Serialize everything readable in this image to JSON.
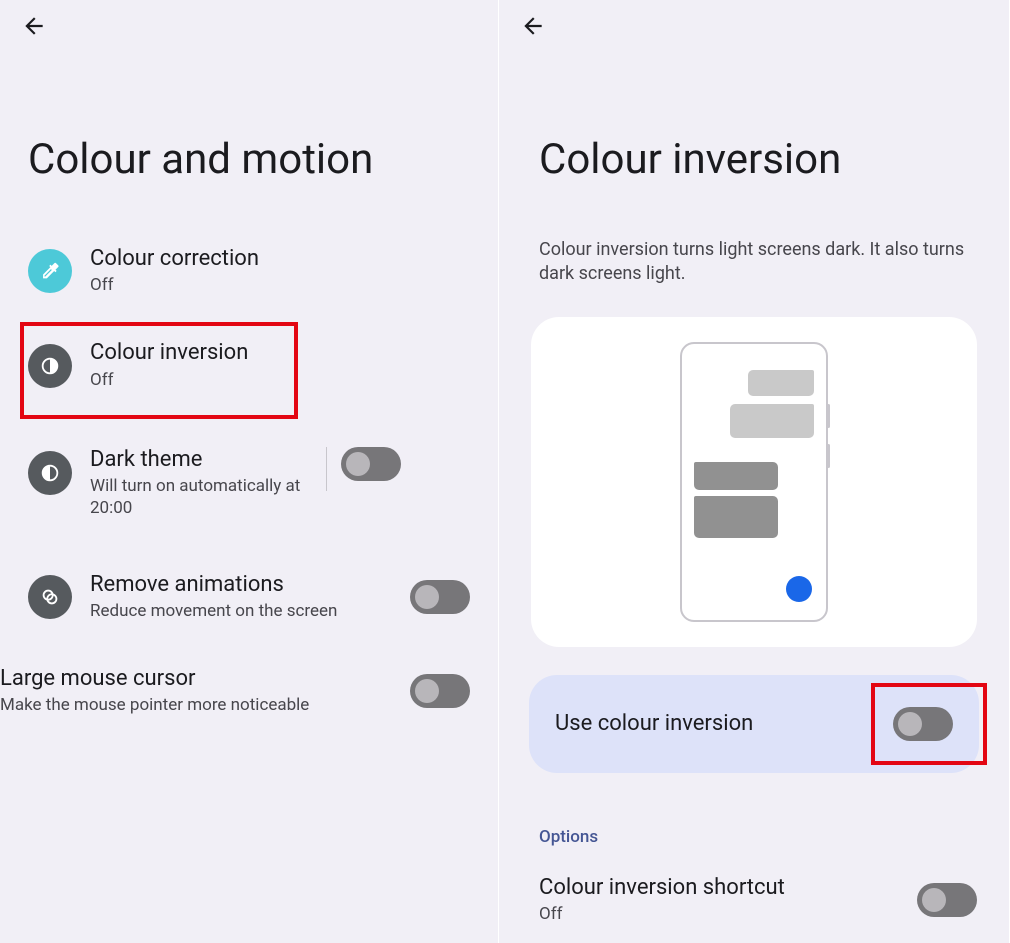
{
  "left": {
    "title": "Colour and motion",
    "items": {
      "colour_correction": {
        "title": "Colour correction",
        "sub": "Off"
      },
      "colour_inversion": {
        "title": "Colour inversion",
        "sub": "Off"
      },
      "dark_theme": {
        "title": "Dark theme",
        "sub": "Will turn on automatically at 20:00"
      },
      "remove_animations": {
        "title": "Remove animations",
        "sub": "Reduce movement on the screen"
      },
      "large_cursor": {
        "title": "Large mouse cursor",
        "sub": "Make the mouse pointer more noticeable"
      }
    }
  },
  "right": {
    "title": "Colour inversion",
    "description": "Colour inversion turns light screens dark. It also turns dark screens light.",
    "use_label": "Use colour inversion",
    "options_header": "Options",
    "shortcut": {
      "title": "Colour inversion shortcut",
      "sub": "Off"
    }
  }
}
